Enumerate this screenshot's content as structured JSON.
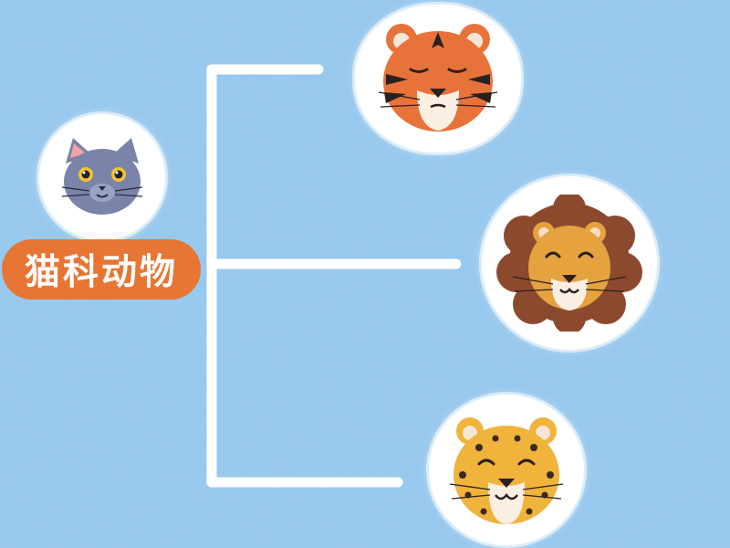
{
  "diagram": {
    "root": {
      "label": "猫科动物",
      "icon": "cat-face-icon"
    },
    "children": [
      {
        "icon": "tiger-face-icon"
      },
      {
        "icon": "lion-face-icon"
      },
      {
        "icon": "leopard-face-icon"
      }
    ]
  },
  "colors": {
    "background": "#8ec3ec",
    "connector": "#ffffff",
    "label_fill": "#e77533",
    "label_text": "#ffffff"
  }
}
